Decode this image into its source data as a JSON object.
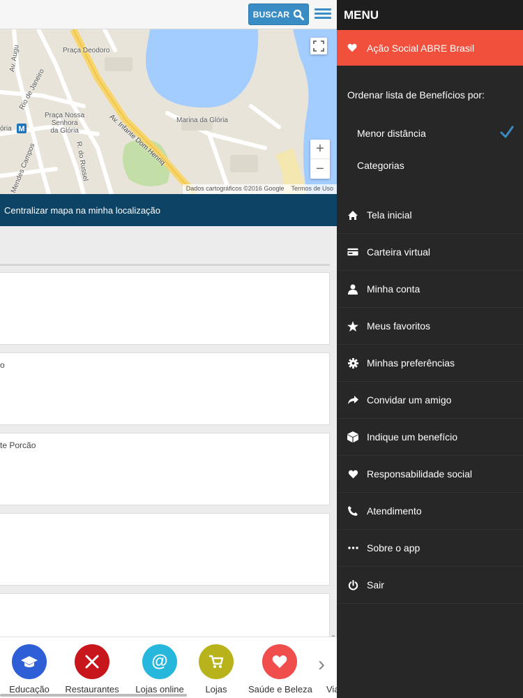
{
  "topbar": {
    "search_label": "BUSCAR"
  },
  "map": {
    "labels": {
      "praca_deodoro": "Praça Deodoro",
      "rio_de_janeiro": "Rio de Janeiro",
      "av_augusto": "Av. Augu",
      "praca_nossa_senhora": "Praça Nossa\nSenhora\nda Glória",
      "oria": "ória",
      "mendes_campos": "Mendes Campos",
      "r_do_russel": "R. do Russel",
      "av_infante": "Av. Infante Dom Henriq",
      "marina": "Marina da Glória"
    },
    "attribution": "Dados cartográficos ©2016 Google",
    "terms": "Termos de Uso",
    "zoom_in": "+",
    "zoom_out": "−"
  },
  "center_map_label": "Centralizar mapa na minha localização",
  "cards": [
    {
      "text": ""
    },
    {
      "text": "o"
    },
    {
      "text": "te Porcão"
    },
    {
      "text": ""
    },
    {
      "text": ""
    }
  ],
  "categories": [
    {
      "label": "Educação",
      "color": "#2e5fd6",
      "icon": "graduation-cap-icon"
    },
    {
      "label": "Restaurantes",
      "color": "#c8161d",
      "icon": "fork-knife-icon"
    },
    {
      "label": "Lojas online",
      "color": "#27b6dc",
      "icon": "at-sign-icon",
      "glyph": "@"
    },
    {
      "label": "Lojas",
      "color": "#b8b21b",
      "icon": "cart-icon"
    },
    {
      "label": "Saúde e Beleza",
      "color": "#f04d4d",
      "icon": "heart-icon"
    },
    {
      "label": "Via",
      "color": "#888888",
      "icon": ""
    }
  ],
  "menu": {
    "title": "MENU",
    "highlight": {
      "label": "Ação Social ABRE Brasil",
      "icon": "heart-icon",
      "color": "#f0503c"
    },
    "sort_title": "Ordenar lista de Benefícios por:",
    "sort_options": [
      {
        "label": "Menor distância",
        "selected": true
      },
      {
        "label": "Categorias",
        "selected": false
      }
    ],
    "items": [
      {
        "label": "Tela inicial",
        "icon": "home-icon"
      },
      {
        "label": "Carteira virtual",
        "icon": "card-icon"
      },
      {
        "label": "Minha conta",
        "icon": "user-icon"
      },
      {
        "label": "Meus favoritos",
        "icon": "star-icon"
      },
      {
        "label": "Minhas preferências",
        "icon": "gear-icon"
      },
      {
        "label": "Convidar um amigo",
        "icon": "share-arrow-icon"
      },
      {
        "label": "Indique um benefício",
        "icon": "box-icon"
      },
      {
        "label": "Responsabilidade social",
        "icon": "heart-icon"
      },
      {
        "label": "Atendimento",
        "icon": "phone-icon"
      },
      {
        "label": "Sobre o app",
        "icon": "ellipsis-icon"
      },
      {
        "label": "Sair",
        "icon": "power-icon"
      }
    ]
  }
}
